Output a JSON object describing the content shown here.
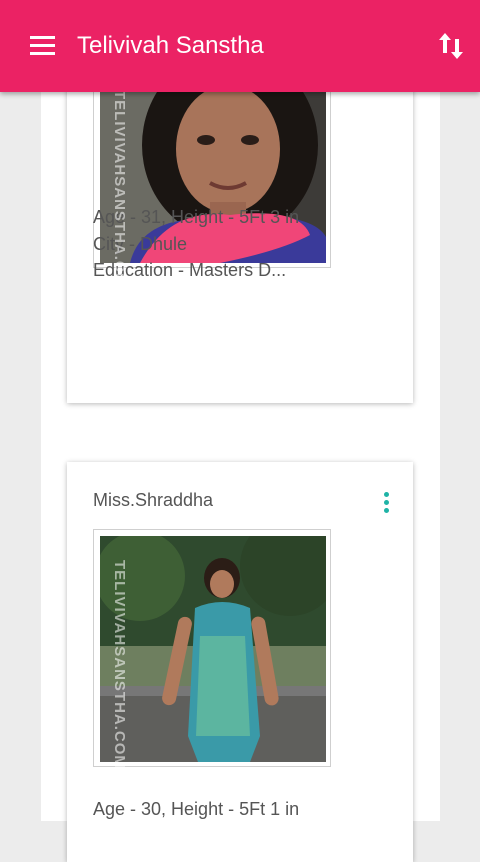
{
  "app_bar": {
    "title": "Telivivah Sanstha",
    "menu_icon": "hamburger-menu-icon",
    "sort_icon": "sort-arrows-icon",
    "color": "#eb2264"
  },
  "profiles": [
    {
      "watermark": "TELIVIVAHSANSTHA.COM",
      "age_height": "Age - 31, Height - 5Ft 3 in",
      "city": "City - Dhule",
      "education": "Education - Masters D..."
    },
    {
      "name": "Miss.Shraddha",
      "menu_icon": "more-vertical-icon",
      "watermark": "TELIVIVAHSANSTHA.COM",
      "age_height": "Age - 30, Height - 5Ft 1 in"
    }
  ]
}
